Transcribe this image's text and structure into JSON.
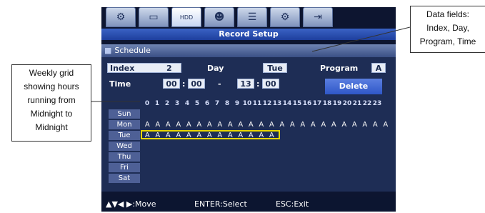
{
  "tabs": [
    {
      "icon": "gear-icon",
      "glyph": "⚙"
    },
    {
      "icon": "monitor-icon",
      "glyph": "▭"
    },
    {
      "icon": "hdd-icon",
      "glyph": "HDD"
    },
    {
      "icon": "users-icon",
      "glyph": "☻"
    },
    {
      "icon": "network-icon",
      "glyph": "☰"
    },
    {
      "icon": "settings-slider-icon",
      "glyph": "⚙"
    },
    {
      "icon": "exit-icon",
      "glyph": "⇥"
    }
  ],
  "title": "Record Setup",
  "panel": {
    "header": "Schedule",
    "index_label": "Index",
    "index_value": "2",
    "day_label": "Day",
    "day_value": "Tue",
    "program_label": "Program",
    "program_value": "A",
    "time_label": "Time",
    "time_start_h": "00",
    "time_start_m": "00",
    "time_sep": ":",
    "time_dash": "-",
    "time_end_h": "13",
    "time_end_m": "00",
    "delete_label": "Delete"
  },
  "hours": [
    "0",
    "1",
    "2",
    "3",
    "4",
    "5",
    "6",
    "7",
    "8",
    "9",
    "10",
    "11",
    "12",
    "13",
    "14",
    "15",
    "16",
    "17",
    "18",
    "19",
    "20",
    "21",
    "22",
    "23"
  ],
  "days": [
    {
      "name": "Sun",
      "slots": []
    },
    {
      "name": "Mon",
      "slots": [
        "A",
        "A",
        "A",
        "A",
        "A",
        "A",
        "A",
        "A",
        "A",
        "A",
        "A",
        "A",
        "A",
        "A",
        "A",
        "A",
        "A",
        "A",
        "A",
        "A",
        "A",
        "A",
        "A",
        "A"
      ]
    },
    {
      "name": "Tue",
      "slots": [
        "A",
        "A",
        "A",
        "A",
        "A",
        "A",
        "A",
        "A",
        "A",
        "A",
        "A",
        "A",
        "A"
      ]
    },
    {
      "name": "Wed",
      "slots": []
    },
    {
      "name": "Thu",
      "slots": []
    },
    {
      "name": "Fri",
      "slots": []
    },
    {
      "name": "Sat",
      "slots": []
    }
  ],
  "footer": {
    "move": "▲▼◀ ▶:Move",
    "select": "ENTER:Select",
    "exit": "ESC:Exit"
  },
  "callouts": {
    "left": [
      "Weekly grid",
      "showing hours",
      "running from",
      "Midnight to",
      "Midnight"
    ],
    "right": [
      "Data fields:",
      "Index, Day,",
      "Program, Time"
    ]
  }
}
